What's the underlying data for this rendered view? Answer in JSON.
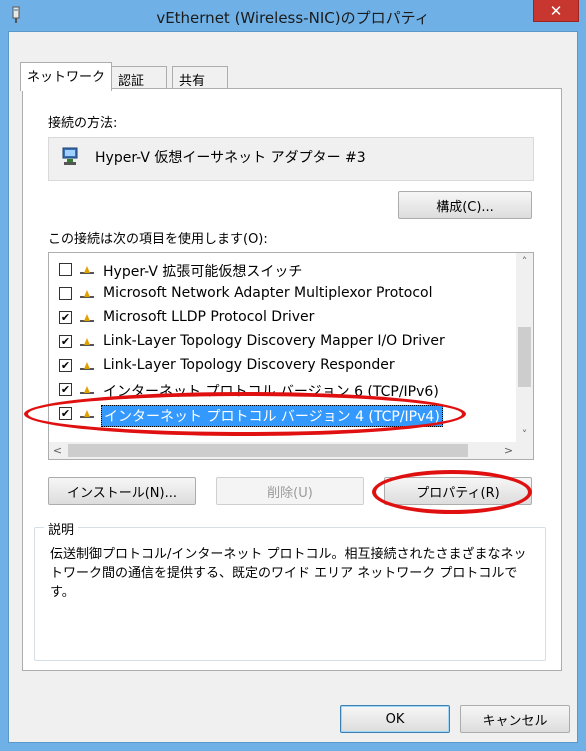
{
  "window": {
    "title": "vEthernet (Wireless-NIC)のプロパティ",
    "close_label": "✕"
  },
  "tabs": [
    {
      "label": "ネットワーク",
      "active": true
    },
    {
      "label": "認証",
      "active": false
    },
    {
      "label": "共有",
      "active": false
    }
  ],
  "connection": {
    "method_label": "接続の方法:",
    "adapter_name": "Hyper-V 仮想イーサネット アダプター #3",
    "configure_button": "構成(C)..."
  },
  "items_section": {
    "label": "この接続は次の項目を使用します(O):",
    "items": [
      {
        "label": "Hyper-V 拡張可能仮想スイッチ",
        "checked": false,
        "selected": false
      },
      {
        "label": "Microsoft Network Adapter Multiplexor Protocol",
        "checked": false,
        "selected": false
      },
      {
        "label": "Microsoft LLDP Protocol Driver",
        "checked": true,
        "selected": false
      },
      {
        "label": "Link-Layer Topology Discovery Mapper I/O Driver",
        "checked": true,
        "selected": false
      },
      {
        "label": "Link-Layer Topology Discovery Responder",
        "checked": true,
        "selected": false
      },
      {
        "label": "インターネット プロトコル バージョン 6 (TCP/IPv6)",
        "checked": true,
        "selected": false
      },
      {
        "label": "インターネット プロトコル バージョン 4 (TCP/IPv4)",
        "checked": true,
        "selected": true
      }
    ],
    "check_mark": "✔"
  },
  "buttons": {
    "install": "インストール(N)...",
    "uninstall": "削除(U)",
    "properties": "プロパティ(R)",
    "ok": "OK",
    "cancel": "キャンセル"
  },
  "description": {
    "legend": "説明",
    "text": "伝送制御プロトコル/インターネット プロトコル。相互接続されたさまざまなネットワーク間の通信を提供する、既定のワイド エリア ネットワーク プロトコルです。"
  },
  "scroll_glyphs": {
    "up": "˄",
    "down": "˅",
    "left": "<",
    "right": ">"
  },
  "colors": {
    "title_bar": "#6fb1e6",
    "close_button": "#c7372f",
    "selection": "#3399ff",
    "annotation": "#e01010"
  }
}
